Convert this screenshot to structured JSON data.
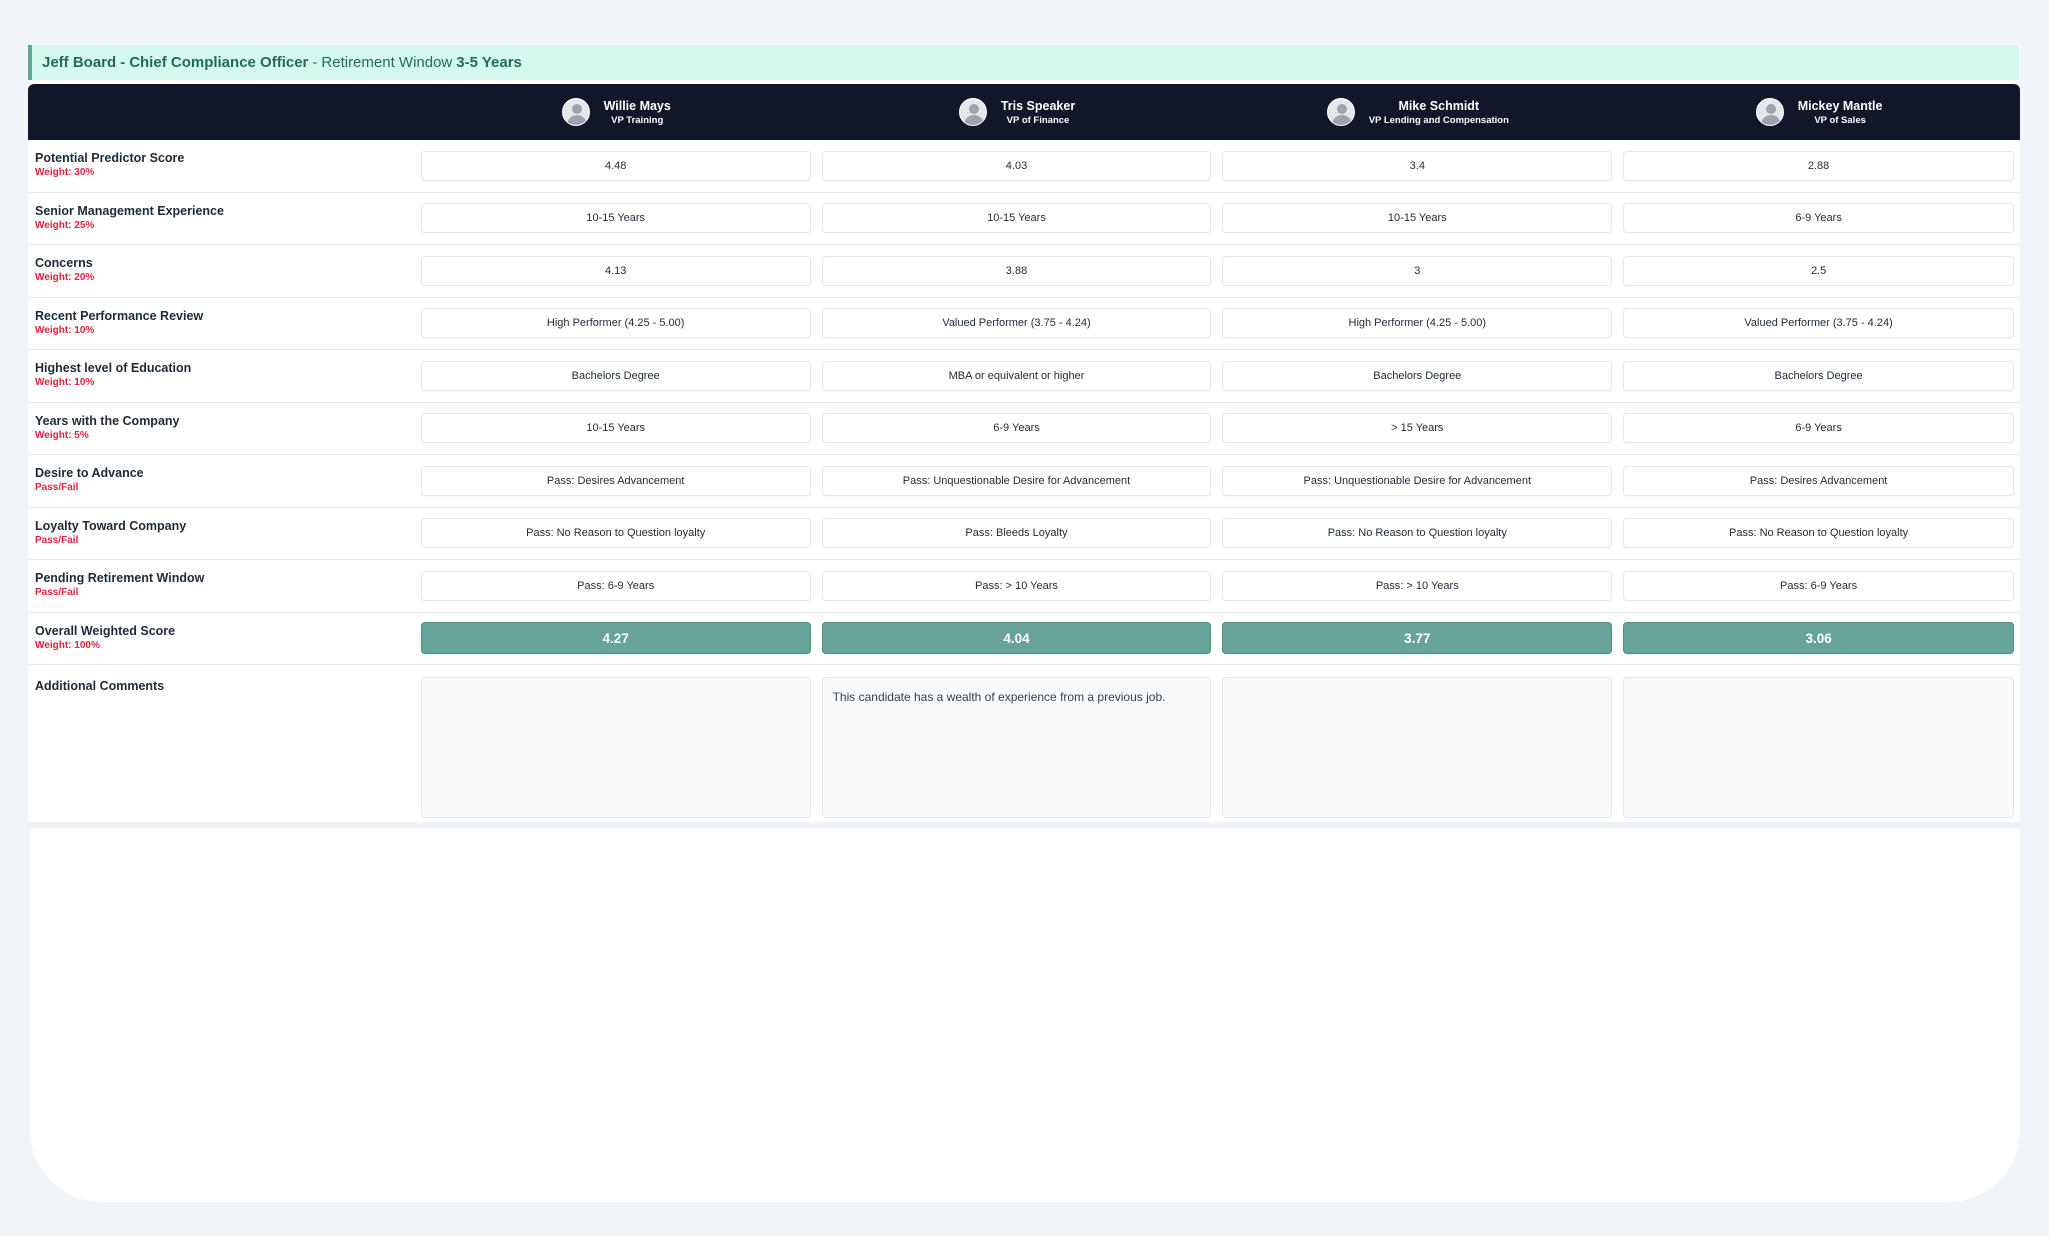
{
  "header": {
    "person": "Jeff Board",
    "position": "Chief Compliance Officer",
    "window_label": "Retirement Window",
    "window_value": "3-5 Years"
  },
  "candidates": [
    {
      "name": "Willie Mays",
      "role": "VP Training"
    },
    {
      "name": "Tris Speaker",
      "role": "VP of Finance"
    },
    {
      "name": "Mike Schmidt",
      "role": "VP Lending and Compensation"
    },
    {
      "name": "Mickey Mantle",
      "role": "VP of Sales"
    }
  ],
  "criteria": [
    {
      "name": "Potential Predictor Score",
      "weight": "Weight: 30%",
      "values": [
        "4.48",
        "4.03",
        "3.4",
        "2.88"
      ]
    },
    {
      "name": "Senior Management Experience",
      "weight": "Weight: 25%",
      "values": [
        "10-15 Years",
        "10-15 Years",
        "10-15 Years",
        "6-9 Years"
      ]
    },
    {
      "name": "Concerns",
      "weight": "Weight: 20%",
      "values": [
        "4.13",
        "3.88",
        "3",
        "2.5"
      ]
    },
    {
      "name": "Recent Performance Review",
      "weight": "Weight: 10%",
      "values": [
        "High Performer (4.25 - 5.00)",
        "Valued Performer (3.75 - 4.24)",
        "High Performer (4.25 - 5.00)",
        "Valued Performer (3.75 - 4.24)"
      ]
    },
    {
      "name": "Highest level of Education",
      "weight": "Weight: 10%",
      "values": [
        "Bachelors Degree",
        "MBA or equivalent or higher",
        "Bachelors Degree",
        "Bachelors Degree"
      ]
    },
    {
      "name": "Years with the Company",
      "weight": "Weight: 5%",
      "values": [
        "10-15 Years",
        "6-9 Years",
        "> 15 Years",
        "6-9 Years"
      ]
    },
    {
      "name": "Desire to Advance",
      "weight": "Pass/Fail",
      "values": [
        "Pass: Desires Advancement",
        "Pass: Unquestionable Desire for Advancement",
        "Pass: Unquestionable Desire for Advancement",
        "Pass: Desires Advancement"
      ]
    },
    {
      "name": "Loyalty Toward Company",
      "weight": "Pass/Fail",
      "values": [
        "Pass: No Reason to Question loyalty",
        "Pass: Bleeds Loyalty",
        "Pass: No Reason to Question loyalty",
        "Pass: No Reason to Question loyalty"
      ]
    },
    {
      "name": "Pending Retirement Window",
      "weight": "Pass/Fail",
      "values": [
        "Pass: 6-9 Years",
        "Pass: > 10 Years",
        "Pass: > 10 Years",
        "Pass: 6-9 Years"
      ]
    }
  ],
  "overall": {
    "name": "Overall Weighted Score",
    "weight": "Weight: 100%",
    "values": [
      "4.27",
      "4.04",
      "3.77",
      "3.06"
    ]
  },
  "comments": {
    "label": "Additional Comments",
    "values": [
      "",
      "This candidate has a wealth of experience from a previous job.",
      "",
      ""
    ]
  },
  "colors": {
    "header_bg": "#111729",
    "title_bg": "#d5f9ef",
    "title_text": "#226a5b",
    "score_bg": "#67a398",
    "weight_text": "#e0233d"
  }
}
